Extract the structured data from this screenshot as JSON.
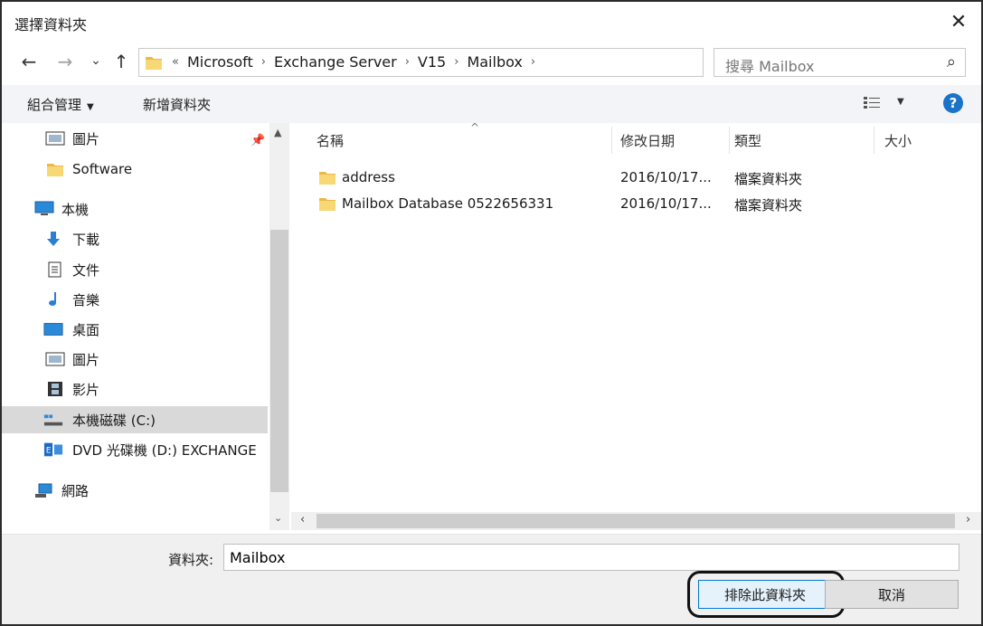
{
  "window": {
    "title": "選擇資料夾",
    "close_glyph": "✕"
  },
  "address_bar": {
    "overflow_glyph": "«",
    "breadcrumbs": [
      "Microsoft",
      "Exchange Server",
      "V15",
      "Mailbox"
    ],
    "search_placeholder": "搜尋 Mailbox"
  },
  "nav_buttons": {
    "back": "←",
    "forward": "→",
    "recent": "⌄",
    "up": "↑"
  },
  "toolbar": {
    "organize_label": "組合管理",
    "new_folder_label": "新增資料夾",
    "help_glyph": "?"
  },
  "sidebar": {
    "items": [
      {
        "label": "圖片",
        "icon": "pictures-icon",
        "pinned": true
      },
      {
        "label": "Software",
        "icon": "folder-icon"
      },
      {
        "label": "本機",
        "icon": "computer-icon"
      },
      {
        "label": "下載",
        "icon": "downloads-icon"
      },
      {
        "label": "文件",
        "icon": "documents-icon"
      },
      {
        "label": "音樂",
        "icon": "music-icon"
      },
      {
        "label": "桌面",
        "icon": "desktop-icon"
      },
      {
        "label": "圖片",
        "icon": "pictures-icon"
      },
      {
        "label": "影片",
        "icon": "videos-icon"
      },
      {
        "label": "本機磁碟 (C:)",
        "icon": "drive-icon",
        "selected": true
      },
      {
        "label": "DVD 光碟機 (D:) EXCHANGE",
        "icon": "dvd-icon"
      },
      {
        "label": "網路",
        "icon": "network-icon"
      }
    ]
  },
  "file_list": {
    "columns": [
      "名稱",
      "修改日期",
      "類型",
      "大小"
    ],
    "rows": [
      {
        "name": "address",
        "modified": "2016/10/17...",
        "type": "檔案資料夾"
      },
      {
        "name": "Mailbox Database 0522656331",
        "modified": "2016/10/17...",
        "type": "檔案資料夾"
      }
    ]
  },
  "footer": {
    "folder_label": "資料夾:",
    "folder_value": "Mailbox",
    "select_button": "排除此資料夾",
    "cancel_button": "取消"
  },
  "colors": {
    "accent": "#0078d7",
    "help_blue": "#1a73c8",
    "folder_yellow": "#f8d775",
    "selected_bg": "#d9d9d9"
  }
}
